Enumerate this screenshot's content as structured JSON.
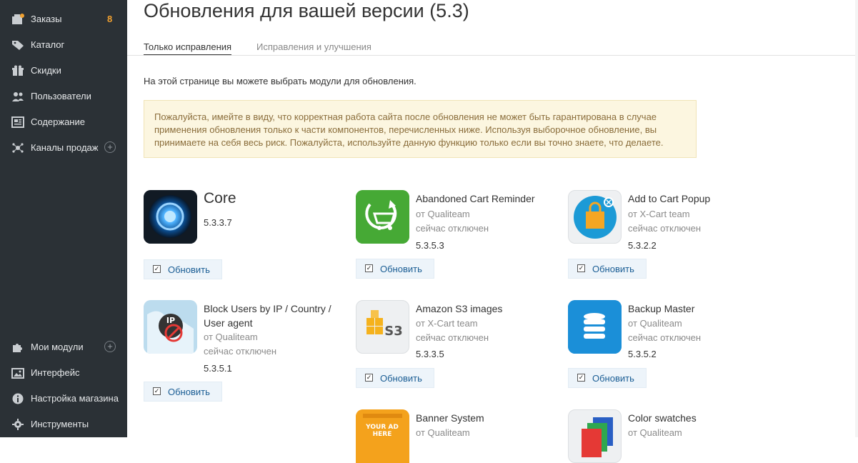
{
  "sidebar": {
    "items": [
      {
        "label": "Заказы",
        "count": "8",
        "icon": "orders-icon"
      },
      {
        "label": "Каталог",
        "icon": "tag-icon"
      },
      {
        "label": "Скидки",
        "icon": "gift-icon"
      },
      {
        "label": "Пользователи",
        "icon": "users-icon"
      },
      {
        "label": "Содержание",
        "icon": "content-icon"
      },
      {
        "label": "Каналы продаж",
        "icon": "sales-channels-icon",
        "plus": "+"
      }
    ],
    "bottom_items": [
      {
        "label": "Мои модули",
        "icon": "puzzle-icon",
        "plus": "+"
      },
      {
        "label": "Интерфейс",
        "icon": "image-icon"
      },
      {
        "label": "Настройка магазина",
        "icon": "info-icon"
      },
      {
        "label": "Инструменты",
        "icon": "gear-icon"
      }
    ],
    "colors": {
      "bg": "#2b3136",
      "badge": "#f0a030"
    }
  },
  "header": {
    "title": "Обновления для вашей версии (5.3)"
  },
  "tabs": [
    {
      "label": "Только исправления",
      "active": true
    },
    {
      "label": "Исправления и улучшения",
      "active": false
    }
  ],
  "intro": "На этой странице вы можете выбрать модули для обновления.",
  "warning": {
    "lines": [
      "Пожалуйста, имейте в виду, что корректная работа сайта после обновления не может быть гарантирована в случае",
      "применения обновления только к части компонентов, перечисленных ниже. Используя выборочное обновление, вы",
      "принимаете на себя весь риск. Пожалуйста, используйте данную функцию только если вы точно знаете, что делаете."
    ]
  },
  "update_label": "Обновить",
  "modules": [
    {
      "name": "Core",
      "version": "5.3.3.7",
      "icon": "core-icon"
    },
    {
      "name": "Abandoned Cart Reminder",
      "author": "от Qualiteam",
      "status": "сейчас отключен",
      "version": "5.3.5.3",
      "icon": "cart-reminder-icon"
    },
    {
      "name": "Add to Cart Popup",
      "author": "от X-Cart team",
      "status": "сейчас отключен",
      "version": "5.3.2.2",
      "icon": "cart-popup-icon"
    },
    {
      "name_lines": [
        "Block Users by IP / Country /",
        "User agent"
      ],
      "author": "от Qualiteam",
      "status": "сейчас отключен",
      "version": "5.3.5.1",
      "icon": "block-ip-icon"
    },
    {
      "name": "Amazon S3 images",
      "author": "от X-Cart team",
      "status": "сейчас отключен",
      "version": "5.3.3.5",
      "icon": "s3-icon",
      "icon_text": "S3"
    },
    {
      "name": "Backup Master",
      "author": "от Qualiteam",
      "status": "сейчас отключен",
      "version": "5.3.5.2",
      "icon": "database-icon"
    },
    {
      "name": "Banner System",
      "author": "от Qualiteam",
      "icon": "banner-icon",
      "icon_text_1": "YOUR AD",
      "icon_text_2": "HERE"
    },
    {
      "name": "Color swatches",
      "author": "от Qualiteam",
      "icon": "color-swatches-icon"
    }
  ]
}
